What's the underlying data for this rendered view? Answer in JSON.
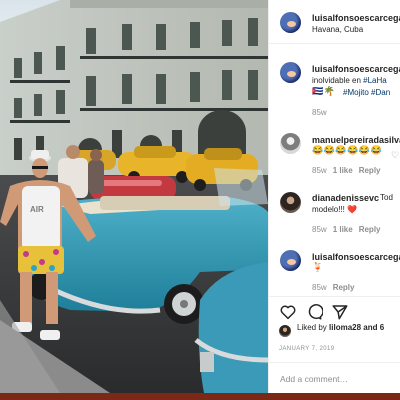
{
  "post": {
    "author": "luisalfonsoescarcega",
    "location": "Havana, Cuba"
  },
  "comments": [
    {
      "user": "luisalfonsoescarcega",
      "text_prefix": "inolvidable en ",
      "text_tag": "#LaHa",
      "tags_line": "#Mojito #Dan",
      "emoji": "🇨🇺🌴",
      "time": "85w",
      "avatar": "owner"
    },
    {
      "user": "manuelpereiradasilva",
      "emoji": "😂😂😂😂😂😂",
      "time": "85w",
      "likes": "1 like",
      "reply": "Reply",
      "avatar": "grey"
    },
    {
      "user": "dianadenissevc",
      "text_after_name": "Tod",
      "text_line2": "modelo!!! ❤️",
      "time": "85w",
      "likes": "1 like",
      "reply": "Reply",
      "avatar": "dark"
    },
    {
      "user": "luisalfonsoescarcega",
      "emoji": "🍹",
      "time": "85w",
      "reply": "Reply",
      "avatar": "owner"
    }
  ],
  "actions": {
    "like_icon": "heart-outline-icon",
    "comment_icon": "comment-bubble-icon",
    "share_icon": "paper-plane-icon"
  },
  "liked_by": {
    "prefix": "Liked by ",
    "user": "liloma28",
    "suffix": " and 6"
  },
  "date": "JANUARY 7, 2019",
  "add_comment_placeholder": "Add a comment…",
  "colors": {
    "tag": "#00376b",
    "muted": "#8e8e8e",
    "text": "#262626",
    "heart_emoji": "#e8453c"
  }
}
